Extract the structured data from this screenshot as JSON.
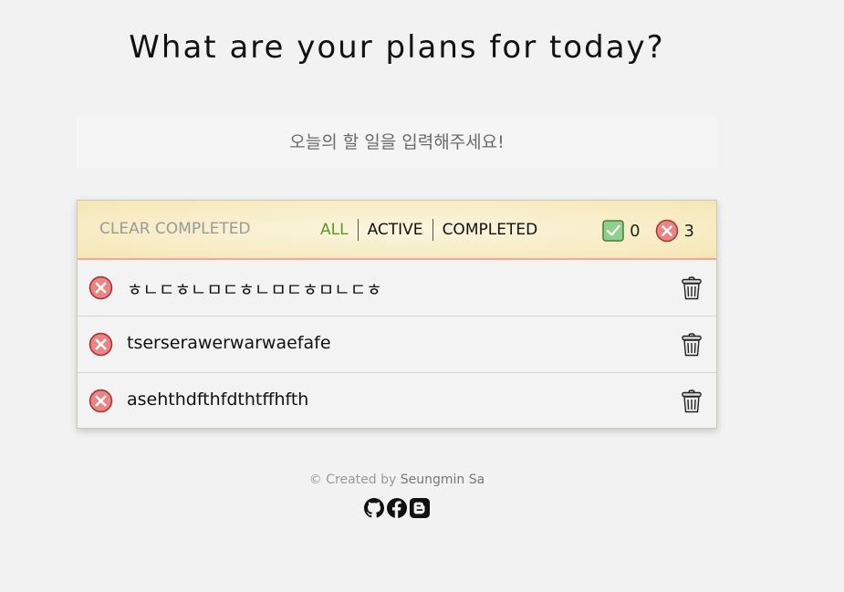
{
  "header": {
    "title": "What are your plans for today?"
  },
  "new_todo": {
    "placeholder": "오늘의 할 일을 입력해주세요!",
    "value": ""
  },
  "toolbar": {
    "clear_label": "CLEAR COMPLETED",
    "filters": [
      {
        "label": "ALL",
        "active": true
      },
      {
        "label": "ACTIVE",
        "active": false
      },
      {
        "label": "COMPLETED",
        "active": false
      }
    ],
    "completed_count": "0",
    "active_count": "3"
  },
  "todos": [
    {
      "text": "ㅎㄴㄷㅎㄴㅁㄷㅎㄴㅁㄷㅎㅁㄴㄷㅎ",
      "completed": false
    },
    {
      "text": "tserserawerwarwaefafe",
      "completed": false
    },
    {
      "text": "asehthdfthfdthtffhfth",
      "completed": false
    }
  ],
  "footer": {
    "created_by": "© Created by",
    "author": "Seungmin Sa",
    "social_icons": [
      "github-icon",
      "facebook-icon",
      "blogger-icon"
    ]
  },
  "colors": {
    "background": "#f2f2f2",
    "active_filter": "#5a9a22",
    "toolbar_gradient_start": "#fbf5df",
    "toolbar_gradient_end": "#f5e7b6",
    "toolbar_border": "#f2a79a",
    "incomplete_icon": "#e98585",
    "complete_icon": "#7fc97a"
  }
}
